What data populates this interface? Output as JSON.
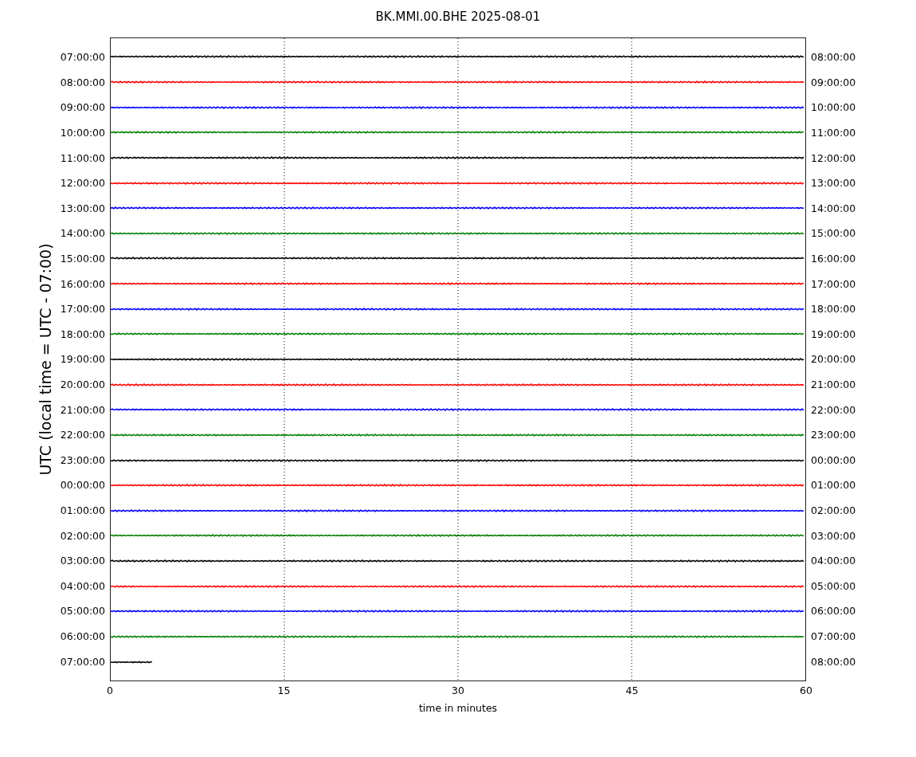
{
  "title": "BK.MMI.00.BHE 2025-08-01",
  "ylabel": "UTC (local time = UTC - 07:00)",
  "xlabel": "time in minutes",
  "xticks": [
    "0",
    "15",
    "30",
    "45",
    "60"
  ],
  "rows": [
    {
      "left": "07:00:00",
      "right": "08:00:00",
      "color": "#000000",
      "level": 1
    },
    {
      "left": "08:00:00",
      "right": "09:00:00",
      "color": "#ff0000",
      "level": 1
    },
    {
      "left": "09:00:00",
      "right": "10:00:00",
      "color": "#0000ff",
      "level": 1
    },
    {
      "left": "10:00:00",
      "right": "11:00:00",
      "color": "#008000",
      "level": 1
    },
    {
      "left": "11:00:00",
      "right": "12:00:00",
      "color": "#000000",
      "level": 1
    },
    {
      "left": "12:00:00",
      "right": "13:00:00",
      "color": "#ff0000",
      "level": 1
    },
    {
      "left": "13:00:00",
      "right": "14:00:00",
      "color": "#0000ff",
      "level": 1
    },
    {
      "left": "14:00:00",
      "right": "15:00:00",
      "color": "#008000",
      "level": 1
    },
    {
      "left": "15:00:00",
      "right": "16:00:00",
      "color": "#000000",
      "level": 1
    },
    {
      "left": "16:00:00",
      "right": "17:00:00",
      "color": "#ff0000",
      "level": 1
    },
    {
      "left": "17:00:00",
      "right": "18:00:00",
      "color": "#0000ff",
      "level": 1
    },
    {
      "left": "18:00:00",
      "right": "19:00:00",
      "color": "#008000",
      "level": 1
    },
    {
      "left": "19:00:00",
      "right": "20:00:00",
      "color": "#000000",
      "level": 1
    },
    {
      "left": "20:00:00",
      "right": "21:00:00",
      "color": "#ff0000",
      "level": 1
    },
    {
      "left": "21:00:00",
      "right": "22:00:00",
      "color": "#0000ff",
      "level": 1
    },
    {
      "left": "22:00:00",
      "right": "23:00:00",
      "color": "#008000",
      "level": 1
    },
    {
      "left": "23:00:00",
      "right": "00:00:00",
      "color": "#000000",
      "level": 1
    },
    {
      "left": "00:00:00",
      "right": "01:00:00",
      "color": "#ff0000",
      "level": 1
    },
    {
      "left": "01:00:00",
      "right": "02:00:00",
      "color": "#0000ff",
      "level": 1
    },
    {
      "left": "02:00:00",
      "right": "03:00:00",
      "color": "#008000",
      "level": 1
    },
    {
      "left": "03:00:00",
      "right": "04:00:00",
      "color": "#000000",
      "level": 1
    },
    {
      "left": "04:00:00",
      "right": "05:00:00",
      "color": "#ff0000",
      "level": 1
    },
    {
      "left": "05:00:00",
      "right": "06:00:00",
      "color": "#0000ff",
      "level": 1
    },
    {
      "left": "06:00:00",
      "right": "07:00:00",
      "color": "#008000",
      "level": 1
    },
    {
      "left": "07:00:00",
      "right": "08:00:00",
      "color": "#000000",
      "level": 0.06
    }
  ]
}
